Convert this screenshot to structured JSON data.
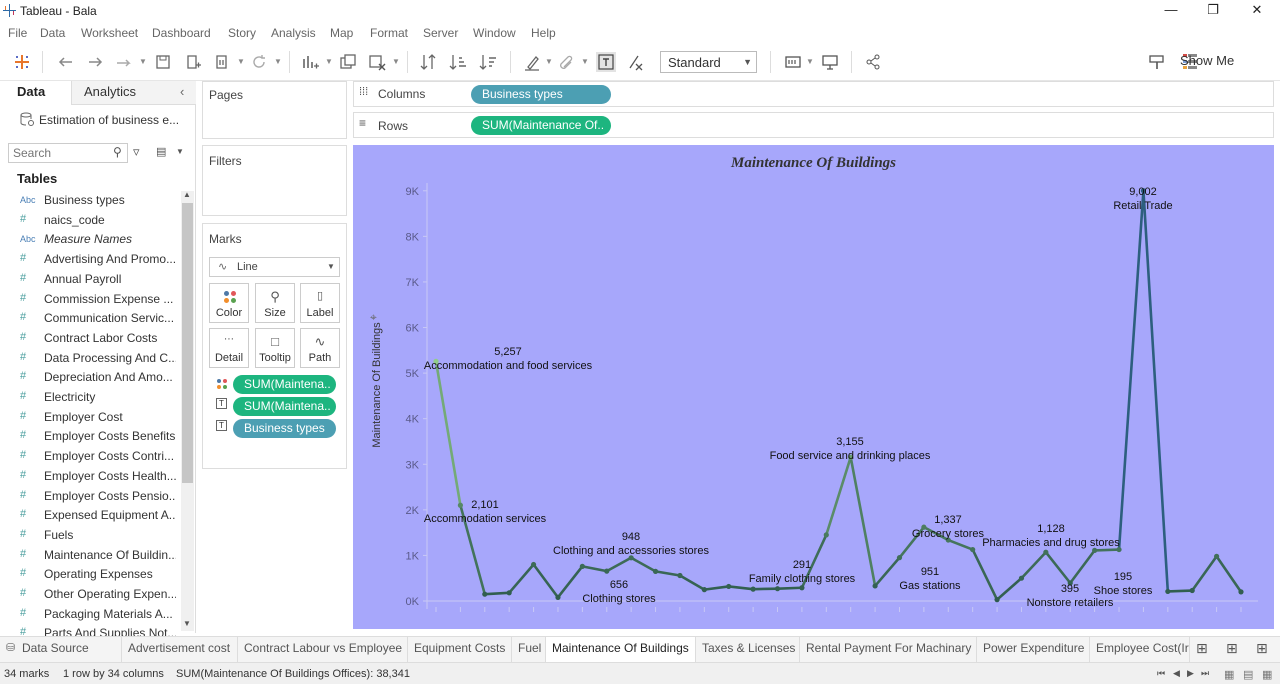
{
  "window": {
    "title": "Tableau - Bala"
  },
  "menu": [
    "File",
    "Data",
    "Worksheet",
    "Dashboard",
    "Story",
    "Analysis",
    "Map",
    "Format",
    "Server",
    "Window",
    "Help"
  ],
  "toolbar": {
    "fit_value": "Standard",
    "show_me": "Show Me"
  },
  "datapane": {
    "tab_data": "Data",
    "tab_analytics": "Analytics",
    "datasource": "Estimation of business e...",
    "search_placeholder": "Search",
    "tables_header": "Tables",
    "fields": [
      {
        "type": "abc",
        "name": "Business types"
      },
      {
        "type": "num",
        "name": "naics_code"
      },
      {
        "type": "abc",
        "name": "Measure Names"
      },
      {
        "type": "num",
        "name": "Advertising And Promo..."
      },
      {
        "type": "num",
        "name": "Annual Payroll"
      },
      {
        "type": "num",
        "name": "Commission Expense ..."
      },
      {
        "type": "num",
        "name": "Communication Servic..."
      },
      {
        "type": "num",
        "name": "Contract Labor Costs"
      },
      {
        "type": "num",
        "name": "Data Processing And C..."
      },
      {
        "type": "num",
        "name": "Depreciation And Amo..."
      },
      {
        "type": "num",
        "name": "Electricity"
      },
      {
        "type": "num",
        "name": "Employer Cost"
      },
      {
        "type": "num",
        "name": "Employer Costs Benefits"
      },
      {
        "type": "num",
        "name": "Employer Costs Contri..."
      },
      {
        "type": "num",
        "name": "Employer Costs Health..."
      },
      {
        "type": "num",
        "name": "Employer Costs Pensio..."
      },
      {
        "type": "num",
        "name": "Expensed Equipment A..."
      },
      {
        "type": "num",
        "name": "Fuels"
      },
      {
        "type": "num",
        "name": "Maintenance Of Buildin..."
      },
      {
        "type": "num",
        "name": "Operating Expenses"
      },
      {
        "type": "num",
        "name": "Other Operating Expen..."
      },
      {
        "type": "num",
        "name": "Packaging Materials A..."
      },
      {
        "type": "num",
        "name": "Parts And Supplies Not..."
      }
    ]
  },
  "pages": {
    "title": "Pages"
  },
  "filters": {
    "title": "Filters"
  },
  "marks": {
    "title": "Marks",
    "type": "Line",
    "buttons": [
      "Color",
      "Size",
      "Label",
      "Detail",
      "Tooltip",
      "Path"
    ],
    "pills": [
      "SUM(Maintena..",
      "SUM(Maintena..",
      "Business types"
    ]
  },
  "shelves": {
    "columns_label": "Columns",
    "columns_pill": "Business types",
    "rows_label": "Rows",
    "rows_pill": "SUM(Maintenance Of.."
  },
  "chart_data": {
    "type": "line",
    "title": "Maintenance Of Buildings",
    "ylabel": "Maintenance Of Buildings",
    "ylim": [
      0,
      9500
    ],
    "yticks": [
      "0K",
      "1K",
      "2K",
      "3K",
      "4K",
      "5K",
      "6K",
      "7K",
      "8K",
      "9K"
    ],
    "values": [
      5257,
      2101,
      150,
      180,
      800,
      80,
      760,
      656,
      948,
      650,
      560,
      250,
      320,
      260,
      270,
      291,
      1450,
      3155,
      330,
      951,
      1620,
      1337,
      1128,
      30,
      500,
      1070,
      395,
      1110,
      1128,
      9002,
      210,
      230,
      980,
      200
    ],
    "labels": [
      {
        "i": 0,
        "value": "5,257",
        "name": "Accommodation and food services"
      },
      {
        "i": 1,
        "value": "2,101",
        "name": "Accommodation services"
      },
      {
        "i": 7,
        "value": "656",
        "name": "Clothing stores"
      },
      {
        "i": 8,
        "value": "948",
        "name": "Clothing and accessories stores"
      },
      {
        "i": 15,
        "value": "291",
        "name": "Family clothing stores"
      },
      {
        "i": 17,
        "value": "3,155",
        "name": "Food service and drinking places"
      },
      {
        "i": 19,
        "value": "951",
        "name": "Gas stations"
      },
      {
        "i": 21,
        "value": "1,337",
        "name": "Grocery stores"
      },
      {
        "i": 24,
        "value": "1,128",
        "name": "Pharmacies and drug stores"
      },
      {
        "i": 26,
        "value": "395",
        "name": "Nonstore retailers"
      },
      {
        "i": 28,
        "value": "195",
        "name": "Shoe stores"
      },
      {
        "i": 29,
        "value": "9,002",
        "name": "Retail Trade"
      }
    ],
    "colors": {
      "low": "#2e5a4e",
      "high_green": "#5ea86a",
      "peak_blue": "#2d5f7e",
      "background": "#a7a7fb"
    }
  },
  "sheets": [
    "Data Source",
    "Advertisement cost",
    "Contract Labour vs Employee",
    "Equipment Costs",
    "Fuel",
    "Maintenance Of Buildings",
    "Taxes & Licenses",
    "Rental Payment For Machinary",
    "Power Expenditure",
    "Employee Cost(Ir"
  ],
  "active_sheet": "Maintenance Of Buildings",
  "status": {
    "marks": "34 marks",
    "dims": "1 row by 34 columns",
    "sum": "SUM(Maintenance Of Buildings Offices): 38,341"
  }
}
